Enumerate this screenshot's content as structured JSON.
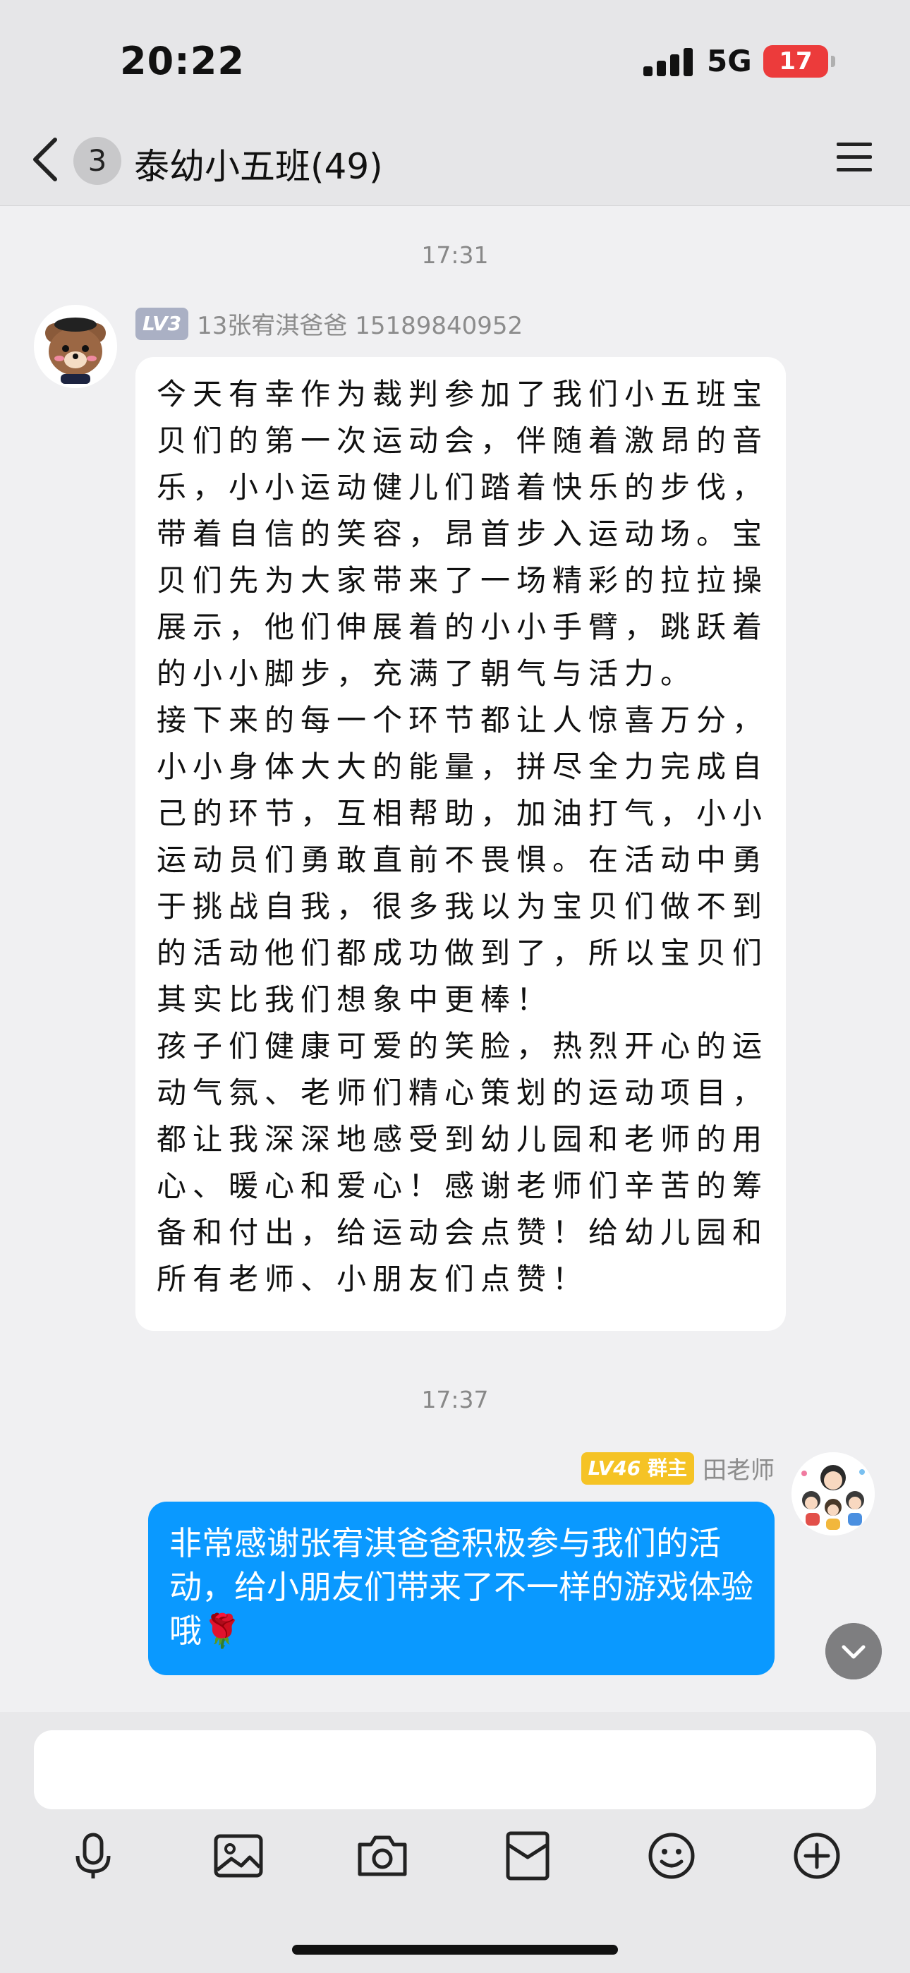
{
  "status_bar": {
    "time": "20:22",
    "network": "5G",
    "battery": "17"
  },
  "header": {
    "unread_count": "3",
    "title": "泰幼小五班(49)"
  },
  "messages": [
    {
      "timestamp": "17:31",
      "level": "LV3",
      "sender": "13张宥淇爸爸 15189840952",
      "text": "今天有幸作为裁判参加了我们小五班宝贝们的第一次运动会，伴随着激昂的音乐，小小运动健儿们踏着快乐的步伐，带着自信的笑容，昂首步入运动场。宝贝们先为大家带来了一场精彩的拉拉操展示，他们伸展着的小小手臂，跳跃着的小小脚步，充满了朝气与活力。\n接下来的每一个环节都让人惊喜万分，小小身体大大的能量，拼尽全力完成自己的环节，互相帮助，加油打气，小小运动员们勇敢直前不畏惧。在活动中勇于挑战自我，很多我以为宝贝们做不到的活动他们都成功做到了，所以宝贝们其实比我们想象中更棒！\n孩子们健康可爱的笑脸，热烈开心的运动气氛、老师们精心策划的运动项目，都让我深深地感受到幼儿园和老师的用心、暖心和爱心！感谢老师们辛苦的筹备和付出，给运动会点赞！给幼儿园和所有老师、小朋友们点赞！"
    },
    {
      "timestamp": "17:37",
      "level": "LV46",
      "role": "群主",
      "sender": "田老师",
      "text": "非常感谢张宥淇爸爸积极参与我们的活动，给小朋友们带来了不一样的游戏体验哦🌹"
    }
  ],
  "icons": [
    "back-arrow-icon",
    "menu-icon",
    "chevron-down-icon",
    "microphone-icon",
    "image-icon",
    "camera-icon",
    "red-packet-icon",
    "emoji-icon",
    "plus-icon"
  ]
}
